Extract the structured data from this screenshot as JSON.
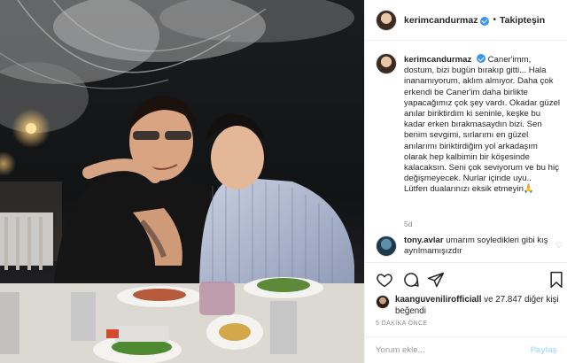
{
  "post": {
    "username": "kerimcandurmaz",
    "follow_label": "Takipteşin",
    "separator": "•",
    "caption_user": "kerimcandurmaz",
    "caption_text": "Caner'imm, dostum, bizi bugün bırakıp gitti... Hala inanamıyorum, aklım almıyor. Daha çok erkendi be Caner'im daha birlikte yapacağımız çok şey vardı. Okadar güzel anılar biriktirdim ki seninle, keşke bu kadar erken bırakmasaydın bizi. Sen benim sevgimi, sırlarımı en güzel anılarımı biriktirdiğim yol arkadaşım olarak hep kalbimin bir köşesinde kalacaksın. Seni çok seviyorum ve bu hiç değişmeyecek. Nurlar içinde uyu..",
    "caption_last_line": "Lütfen dualarınızı eksik etmeyin",
    "caption_emoji": "🙏",
    "caption_time": "5d",
    "comment_user": "tony.avlar",
    "comment_text": "umarım soyledikleri gibi kış ayrılmamışızdır",
    "likes_user": "kaanguvenilirofficiall",
    "likes_rest": "ve 27.847 diğer kişi",
    "likes_line2": "beğendi",
    "time_ago": "5 DAKİKA ÖNCE",
    "comment_placeholder": "Yorum ekle...",
    "post_button": "Paylaş"
  },
  "icons": {
    "like": "heart-icon",
    "comment": "comment-icon",
    "share": "share-icon",
    "save": "bookmark-icon",
    "verified": "verified-badge-icon"
  },
  "colors": {
    "verified": "#3897f0",
    "post_button_disabled": "#b2dffc"
  }
}
